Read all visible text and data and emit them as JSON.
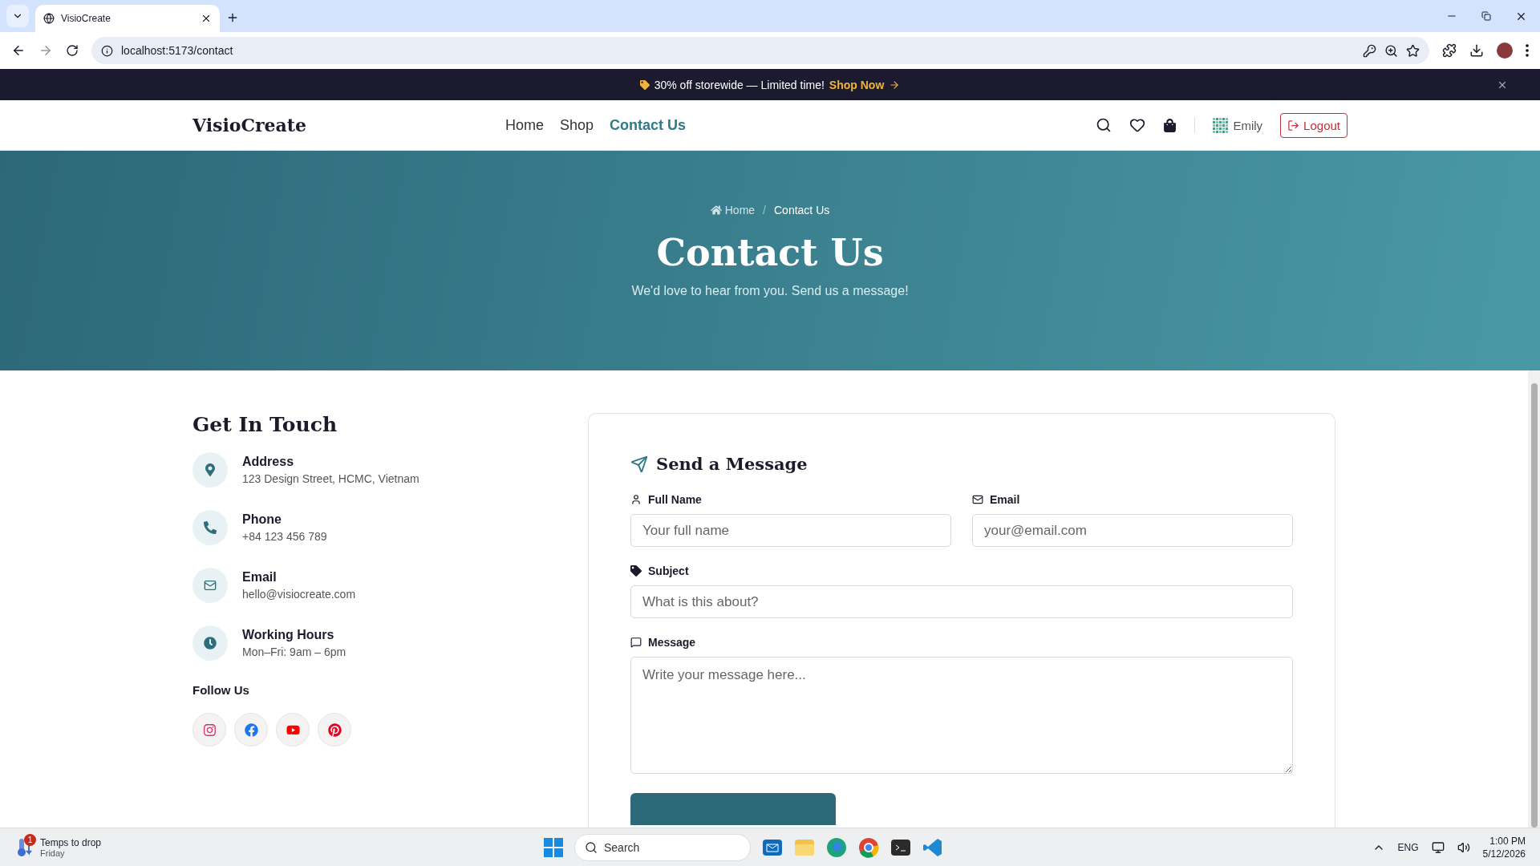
{
  "browser": {
    "tab_title": "VisioCreate",
    "url": "localhost:5173/contact"
  },
  "promo": {
    "text": "30% off storewide — Limited time!",
    "link": "Shop Now"
  },
  "nav": {
    "logo": "VisioCreate",
    "links": [
      {
        "label": "Home",
        "selected": false
      },
      {
        "label": "Shop",
        "selected": false
      },
      {
        "label": "Contact Us",
        "selected": true
      }
    ],
    "user": "Emily",
    "logout": "Logout"
  },
  "hero": {
    "separator": "/",
    "breadcrumb": [
      {
        "label": "Home",
        "selected": false
      },
      {
        "label": "Contact Us",
        "selected": true
      }
    ],
    "title": "Contact Us",
    "subtitle": "We'd love to hear from you. Send us a message!"
  },
  "contact": {
    "title": "Get In Touch",
    "items": [
      {
        "kind": "address",
        "label": "Address",
        "value": "123 Design Street, HCMC, Vietnam"
      },
      {
        "kind": "phone",
        "label": "Phone",
        "value": "+84 123 456 789"
      },
      {
        "kind": "email",
        "label": "Email",
        "value": "hello@visiocreate.com"
      },
      {
        "kind": "hours",
        "label": "Working Hours",
        "value": "Mon–Fri: 9am – 6pm"
      }
    ],
    "follow_title": "Follow Us",
    "socials": [
      {
        "kind": "instagram"
      },
      {
        "kind": "facebook"
      },
      {
        "kind": "youtube"
      },
      {
        "kind": "pinterest"
      }
    ]
  },
  "form": {
    "title": "Send a Message",
    "fields": [
      {
        "kind": "name",
        "label": "Full Name",
        "placeholder": "Your full name"
      },
      {
        "kind": "email",
        "label": "Email",
        "placeholder": "your@email.com"
      },
      {
        "kind": "subject",
        "label": "Subject",
        "placeholder": "What is this about?"
      },
      {
        "kind": "message",
        "label": "Message",
        "placeholder": "Write your message here..."
      }
    ]
  },
  "taskbar": {
    "weather": {
      "title": "Temps to drop",
      "subtitle": "Friday",
      "badge": "1"
    },
    "search": "Search",
    "language": "ENG",
    "time": "1:00 PM",
    "date": "5/12/2026"
  }
}
